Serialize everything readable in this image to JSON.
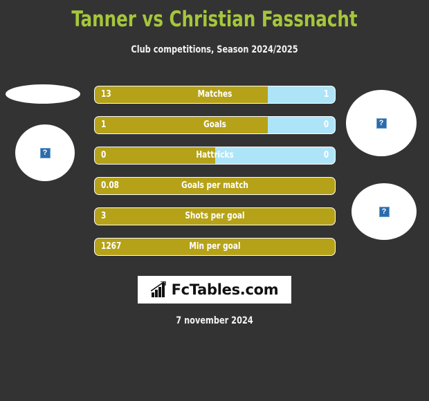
{
  "header": {
    "title": "Tanner vs Christian Fassnacht",
    "subtitle": "Club competitions, Season 2024/2025",
    "title_color": "#a5c63b"
  },
  "colors": {
    "background": "#333333",
    "player1_bar": "#b5a218",
    "player2_bar": "#aee4f8",
    "text": "#ffffff"
  },
  "placeholders": {
    "left_flag": {
      "name": "broken-image",
      "glyph": "?"
    },
    "left_face": {
      "name": "broken-image",
      "glyph": "?"
    },
    "right_face": {
      "name": "broken-image",
      "glyph": "?"
    },
    "right_flag": {
      "name": "broken-image",
      "glyph": "?"
    }
  },
  "chart_data": {
    "type": "bar",
    "title": "Tanner vs Christian Fassnacht",
    "subtitle": "Club competitions, Season 2024/2025",
    "orientation": "horizontal-diverging",
    "legend": [
      "Tanner",
      "Christian Fassnacht"
    ],
    "categories": [
      "Matches",
      "Goals",
      "Hattricks",
      "Goals per match",
      "Shots per goal",
      "Min per goal"
    ],
    "series": [
      {
        "name": "Tanner",
        "values": [
          13,
          1,
          0,
          0.08,
          3,
          1267
        ],
        "color": "#b5a218"
      },
      {
        "name": "Christian Fassnacht",
        "values": [
          1,
          0,
          0,
          null,
          null,
          null
        ],
        "color": "#aee4f8"
      }
    ],
    "rows": [
      {
        "label": "Matches",
        "left": "13",
        "right": "1",
        "left_pct": 72,
        "right_shown": true
      },
      {
        "label": "Goals",
        "left": "1",
        "right": "0",
        "left_pct": 72,
        "right_shown": true
      },
      {
        "label": "Hattricks",
        "left": "0",
        "right": "0",
        "left_pct": 50,
        "right_shown": true
      },
      {
        "label": "Goals per match",
        "left": "0.08",
        "right": "",
        "left_pct": 100,
        "right_shown": false
      },
      {
        "label": "Shots per goal",
        "left": "3",
        "right": "",
        "left_pct": 100,
        "right_shown": false
      },
      {
        "label": "Min per goal",
        "left": "1267",
        "right": "",
        "left_pct": 100,
        "right_shown": false
      }
    ]
  },
  "footer": {
    "logo_text": "FcTables.com",
    "logo_icon": "bar-chart-growth-icon",
    "date": "7 november 2024"
  }
}
